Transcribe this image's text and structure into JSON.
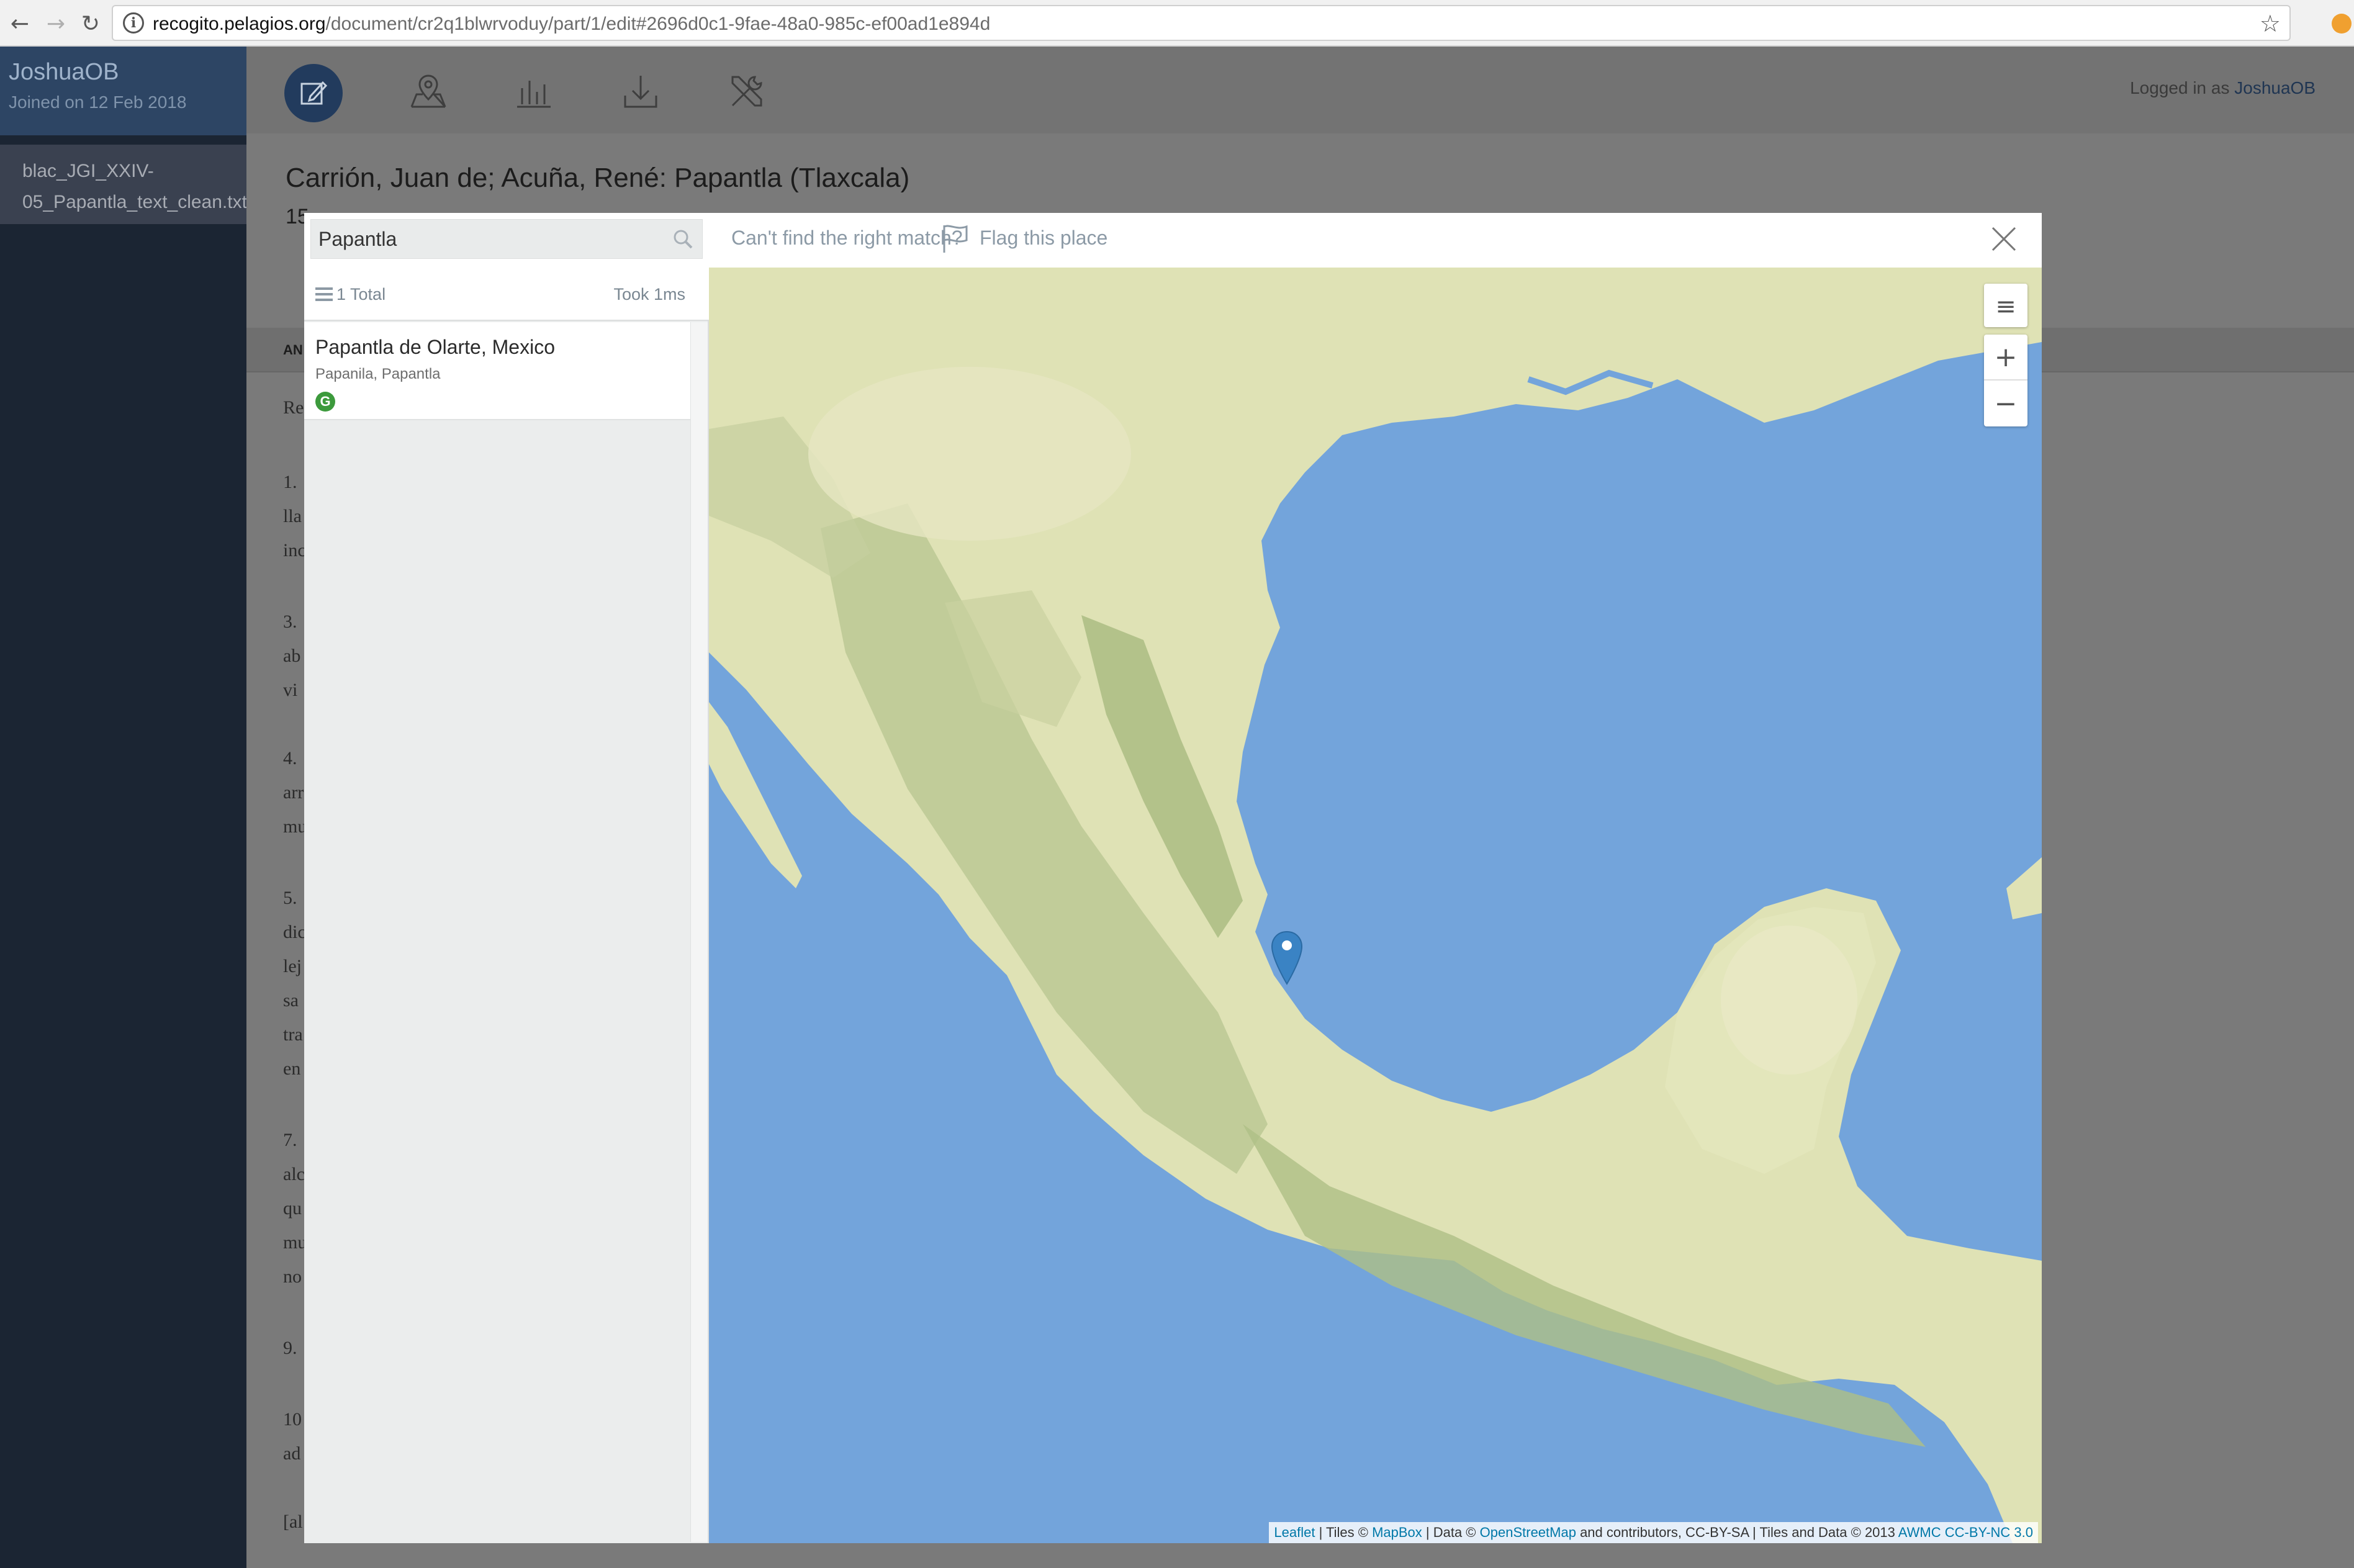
{
  "browser": {
    "url_host": "recogito.pelagios.org",
    "url_path": "/document/cr2q1blwrvoduy/part/1/edit#2696d0c1-9fae-48a0-985c-ef00ad1e894d",
    "back": "←",
    "forward": "→",
    "reload": "↻",
    "info": "i",
    "star": "☆"
  },
  "sidebar": {
    "user_name": "JoshuaOB",
    "joined": "Joined on 12 Feb 2018",
    "document_item": "blac_JGI_XXIV-05_Papantla_text_clean.txt"
  },
  "header": {
    "logged_in_prefix": "Logged in as ",
    "logged_in_user": "JoshuaOB",
    "doc_title": "Carrión, Juan de; Acuña, René: Papantla (Tlaxcala)",
    "doc_sub": "15",
    "tab_fragment": "AN"
  },
  "background_fragments": [
    "Re",
    "1.",
    "lla",
    "inc",
    "3.",
    "ab",
    "vi",
    "4.",
    "arr",
    "mu",
    "5.",
    "dic",
    "lej",
    "sa",
    "tra",
    "en",
    "7.",
    "alc",
    "qu",
    "mu",
    "no",
    "9.",
    "10",
    "ad",
    "[al"
  ],
  "modal": {
    "search_value": "Papantla",
    "cant_find": "Can't find the right match?",
    "flag_label": "Flag this place",
    "results_total": "1 Total",
    "results_took": "Took 1ms",
    "results": [
      {
        "title": "Papantla de Olarte, Mexico",
        "alt_names": "Papanila, Papantla",
        "gazetteer_badge": "G"
      }
    ]
  },
  "map": {
    "zoom_in": "+",
    "zoom_out": "−",
    "layers": "≡",
    "attribution": {
      "leaflet": "Leaflet",
      "tiles_prefix": " | Tiles © ",
      "mapbox": "MapBox",
      "data_prefix": " | Data © ",
      "osm": "OpenStreetMap",
      "mid": " and contributors, CC-BY-SA | Tiles and Data © 2013 ",
      "awmc": "AWMC",
      "license": "CC-BY-NC 3.0"
    }
  },
  "colors": {
    "accent": "#223b5d",
    "sea": "#73a4db",
    "land": "#dfe3b6",
    "marker": "#3a83c4"
  }
}
